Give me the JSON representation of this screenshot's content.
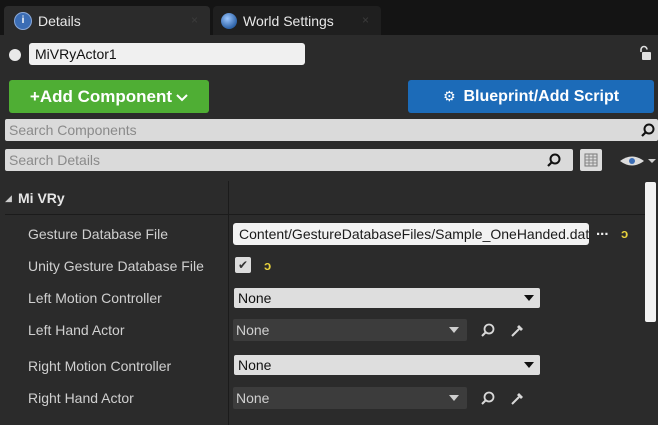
{
  "tabs": [
    {
      "label": "Details",
      "icon": "details-info-icon",
      "close": "×"
    },
    {
      "label": "World Settings",
      "icon": "world-globe-icon",
      "close": "×"
    }
  ],
  "actor": {
    "name": "MiVRyActor1"
  },
  "toolbar": {
    "add_component": "+Add Component",
    "blueprint": "Blueprint/Add Script"
  },
  "search": {
    "components_placeholder": "Search Components",
    "details_placeholder": "Search Details"
  },
  "category": {
    "label": "Mi VRy"
  },
  "properties": {
    "gesture_db_file": {
      "label": "Gesture Database File",
      "value": "Content/GestureDatabaseFiles/Sample_OneHanded.dat",
      "browse": "..."
    },
    "unity_gesture_db": {
      "label": "Unity Gesture Database File",
      "checked": true,
      "check_mark": "✔"
    },
    "left_motion_controller": {
      "label": "Left Motion Controller",
      "value": "None"
    },
    "left_hand_actor": {
      "label": "Left Hand Actor",
      "value": "None"
    },
    "right_motion_controller": {
      "label": "Right Motion Controller",
      "value": "None"
    },
    "right_hand_actor": {
      "label": "Right Hand Actor",
      "value": "None"
    }
  },
  "reset_glyph": "ↄ",
  "colors": {
    "add_button": "#4fae34",
    "blueprint_button": "#1c6bb8",
    "reset_arrow": "#e8d23d"
  }
}
